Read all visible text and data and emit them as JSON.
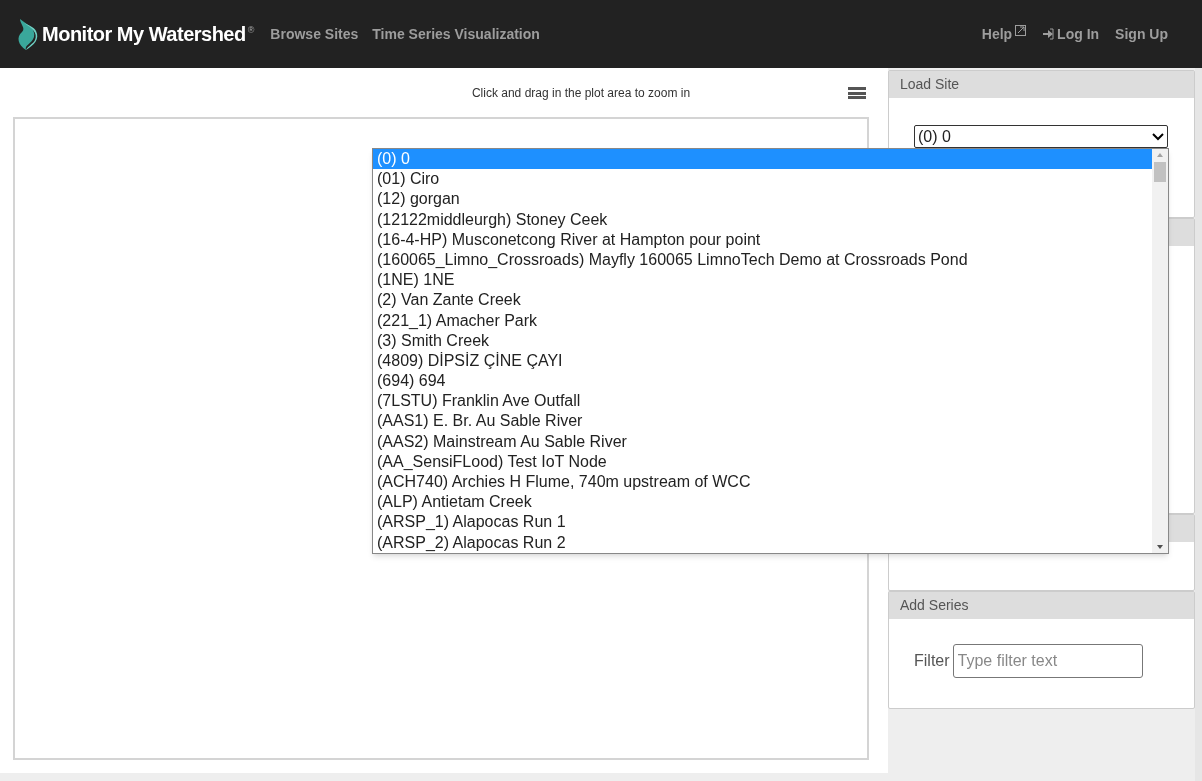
{
  "navbar": {
    "brand": "Monitor My Watershed",
    "brand_mark": "®",
    "links": [
      {
        "label": "Browse Sites"
      },
      {
        "label": "Time Series Visualization"
      }
    ],
    "right_links": [
      {
        "label": "Help",
        "kind": "external"
      },
      {
        "label": "Log In",
        "kind": "login"
      },
      {
        "label": "Sign Up",
        "kind": "plain"
      }
    ]
  },
  "plot": {
    "hint": "Click and drag in the plot area to zoom in"
  },
  "panels": [
    {
      "title": "Load Site",
      "kind": "site"
    },
    {
      "kind": "blank"
    },
    {
      "kind": "blank_short"
    },
    {
      "title": "Add Series",
      "kind": "filter"
    }
  ],
  "site_select": {
    "value": "(0) 0",
    "expanded": true,
    "options": [
      {
        "label": "(0) 0",
        "selected": true
      },
      {
        "label": "(01) Ciro",
        "selected": false
      },
      {
        "label": "(12) gorgan",
        "selected": false
      },
      {
        "label": "(12122middleurgh) Stoney Ceek",
        "selected": false
      },
      {
        "label": "(16-4-HP) Musconetcong River at Hampton pour point",
        "selected": false
      },
      {
        "label": "(160065_Limno_Crossroads) Mayfly 160065 LimnoTech Demo at Crossroads Pond",
        "selected": false
      },
      {
        "label": "(1NE) 1NE",
        "selected": false
      },
      {
        "label": "(2) Van Zante Creek",
        "selected": false
      },
      {
        "label": "(221_1) Amacher Park",
        "selected": false
      },
      {
        "label": "(3) Smith Creek",
        "selected": false
      },
      {
        "label": "(4809) DİPSİZ ÇİNE ÇAYI",
        "selected": false
      },
      {
        "label": "(694) 694",
        "selected": false
      },
      {
        "label": "(7LSTU) Franklin Ave Outfall",
        "selected": false
      },
      {
        "label": "(AAS1) E. Br. Au Sable River",
        "selected": false
      },
      {
        "label": "(AAS2) Mainstream Au Sable River",
        "selected": false
      },
      {
        "label": "(AA_SensiFLood) Test IoT Node",
        "selected": false
      },
      {
        "label": "(ACH740) Archies H Flume, 740m upstream of WCC",
        "selected": false
      },
      {
        "label": "(ALP) Antietam Creek",
        "selected": false
      },
      {
        "label": "(ARSP_1) Alapocas Run 1",
        "selected": false
      },
      {
        "label": "(ARSP_2) Alapocas Run 2",
        "selected": false
      }
    ]
  },
  "filter": {
    "label": "Filter",
    "placeholder": "Type filter text"
  }
}
